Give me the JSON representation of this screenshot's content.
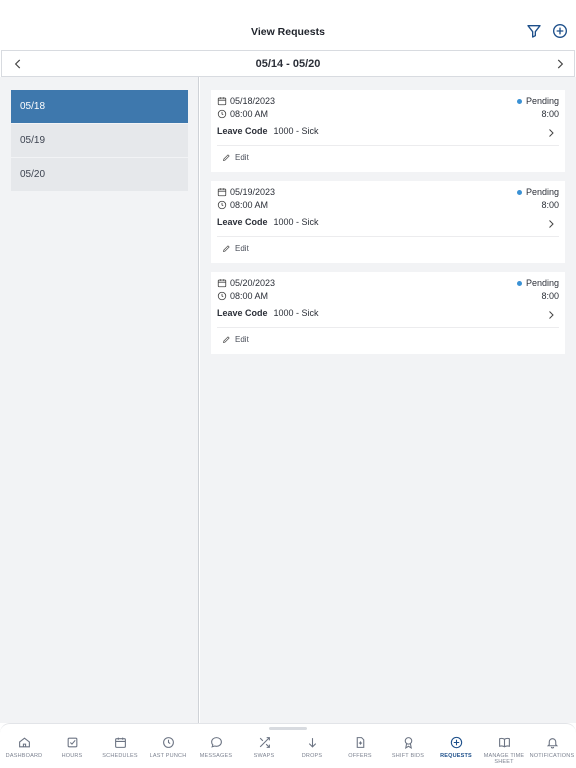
{
  "header": {
    "title": "View Requests",
    "filter_icon": "filter-icon",
    "add_icon": "plus-circle-icon"
  },
  "date_bar": {
    "range": "05/14 - 05/20"
  },
  "days": [
    {
      "label": "05/18",
      "selected": true
    },
    {
      "label": "05/19",
      "selected": false
    },
    {
      "label": "05/20",
      "selected": false
    }
  ],
  "requests": [
    {
      "date": "05/18/2023",
      "time": "08:00 AM",
      "status": "Pending",
      "hours": "8:00",
      "leave_label": "Leave Code",
      "leave_value": "1000 - Sick",
      "edit_label": "Edit"
    },
    {
      "date": "05/19/2023",
      "time": "08:00 AM",
      "status": "Pending",
      "hours": "8:00",
      "leave_label": "Leave Code",
      "leave_value": "1000 - Sick",
      "edit_label": "Edit"
    },
    {
      "date": "05/20/2023",
      "time": "08:00 AM",
      "status": "Pending",
      "hours": "8:00",
      "leave_label": "Leave Code",
      "leave_value": "1000 - Sick",
      "edit_label": "Edit"
    }
  ],
  "tabs": [
    {
      "label": "DASHBOARD",
      "icon": "home-icon"
    },
    {
      "label": "HOURS",
      "icon": "checkbox-icon"
    },
    {
      "label": "SCHEDULES",
      "icon": "calendar-icon"
    },
    {
      "label": "LAST PUNCH",
      "icon": "clock-icon"
    },
    {
      "label": "MESSAGES",
      "icon": "chat-bubble-icon"
    },
    {
      "label": "SWAPS",
      "icon": "shuffle-icon"
    },
    {
      "label": "DROPS",
      "icon": "arrow-down-icon"
    },
    {
      "label": "OFFERS",
      "icon": "document-plus-icon"
    },
    {
      "label": "SHIFT BIDS",
      "icon": "award-icon"
    },
    {
      "label": "REQUESTS",
      "icon": "plus-circle-icon",
      "active": true
    },
    {
      "label": "MANAGE TIME SHEET",
      "icon": "book-icon"
    },
    {
      "label": "NOTIFICATIONS",
      "icon": "bell-icon"
    }
  ],
  "colors": {
    "accent": "#1d4f8a",
    "selected_day": "#3e78ad",
    "status_dot": "#3a91d4",
    "panel_bg": "#f2f3f5"
  }
}
